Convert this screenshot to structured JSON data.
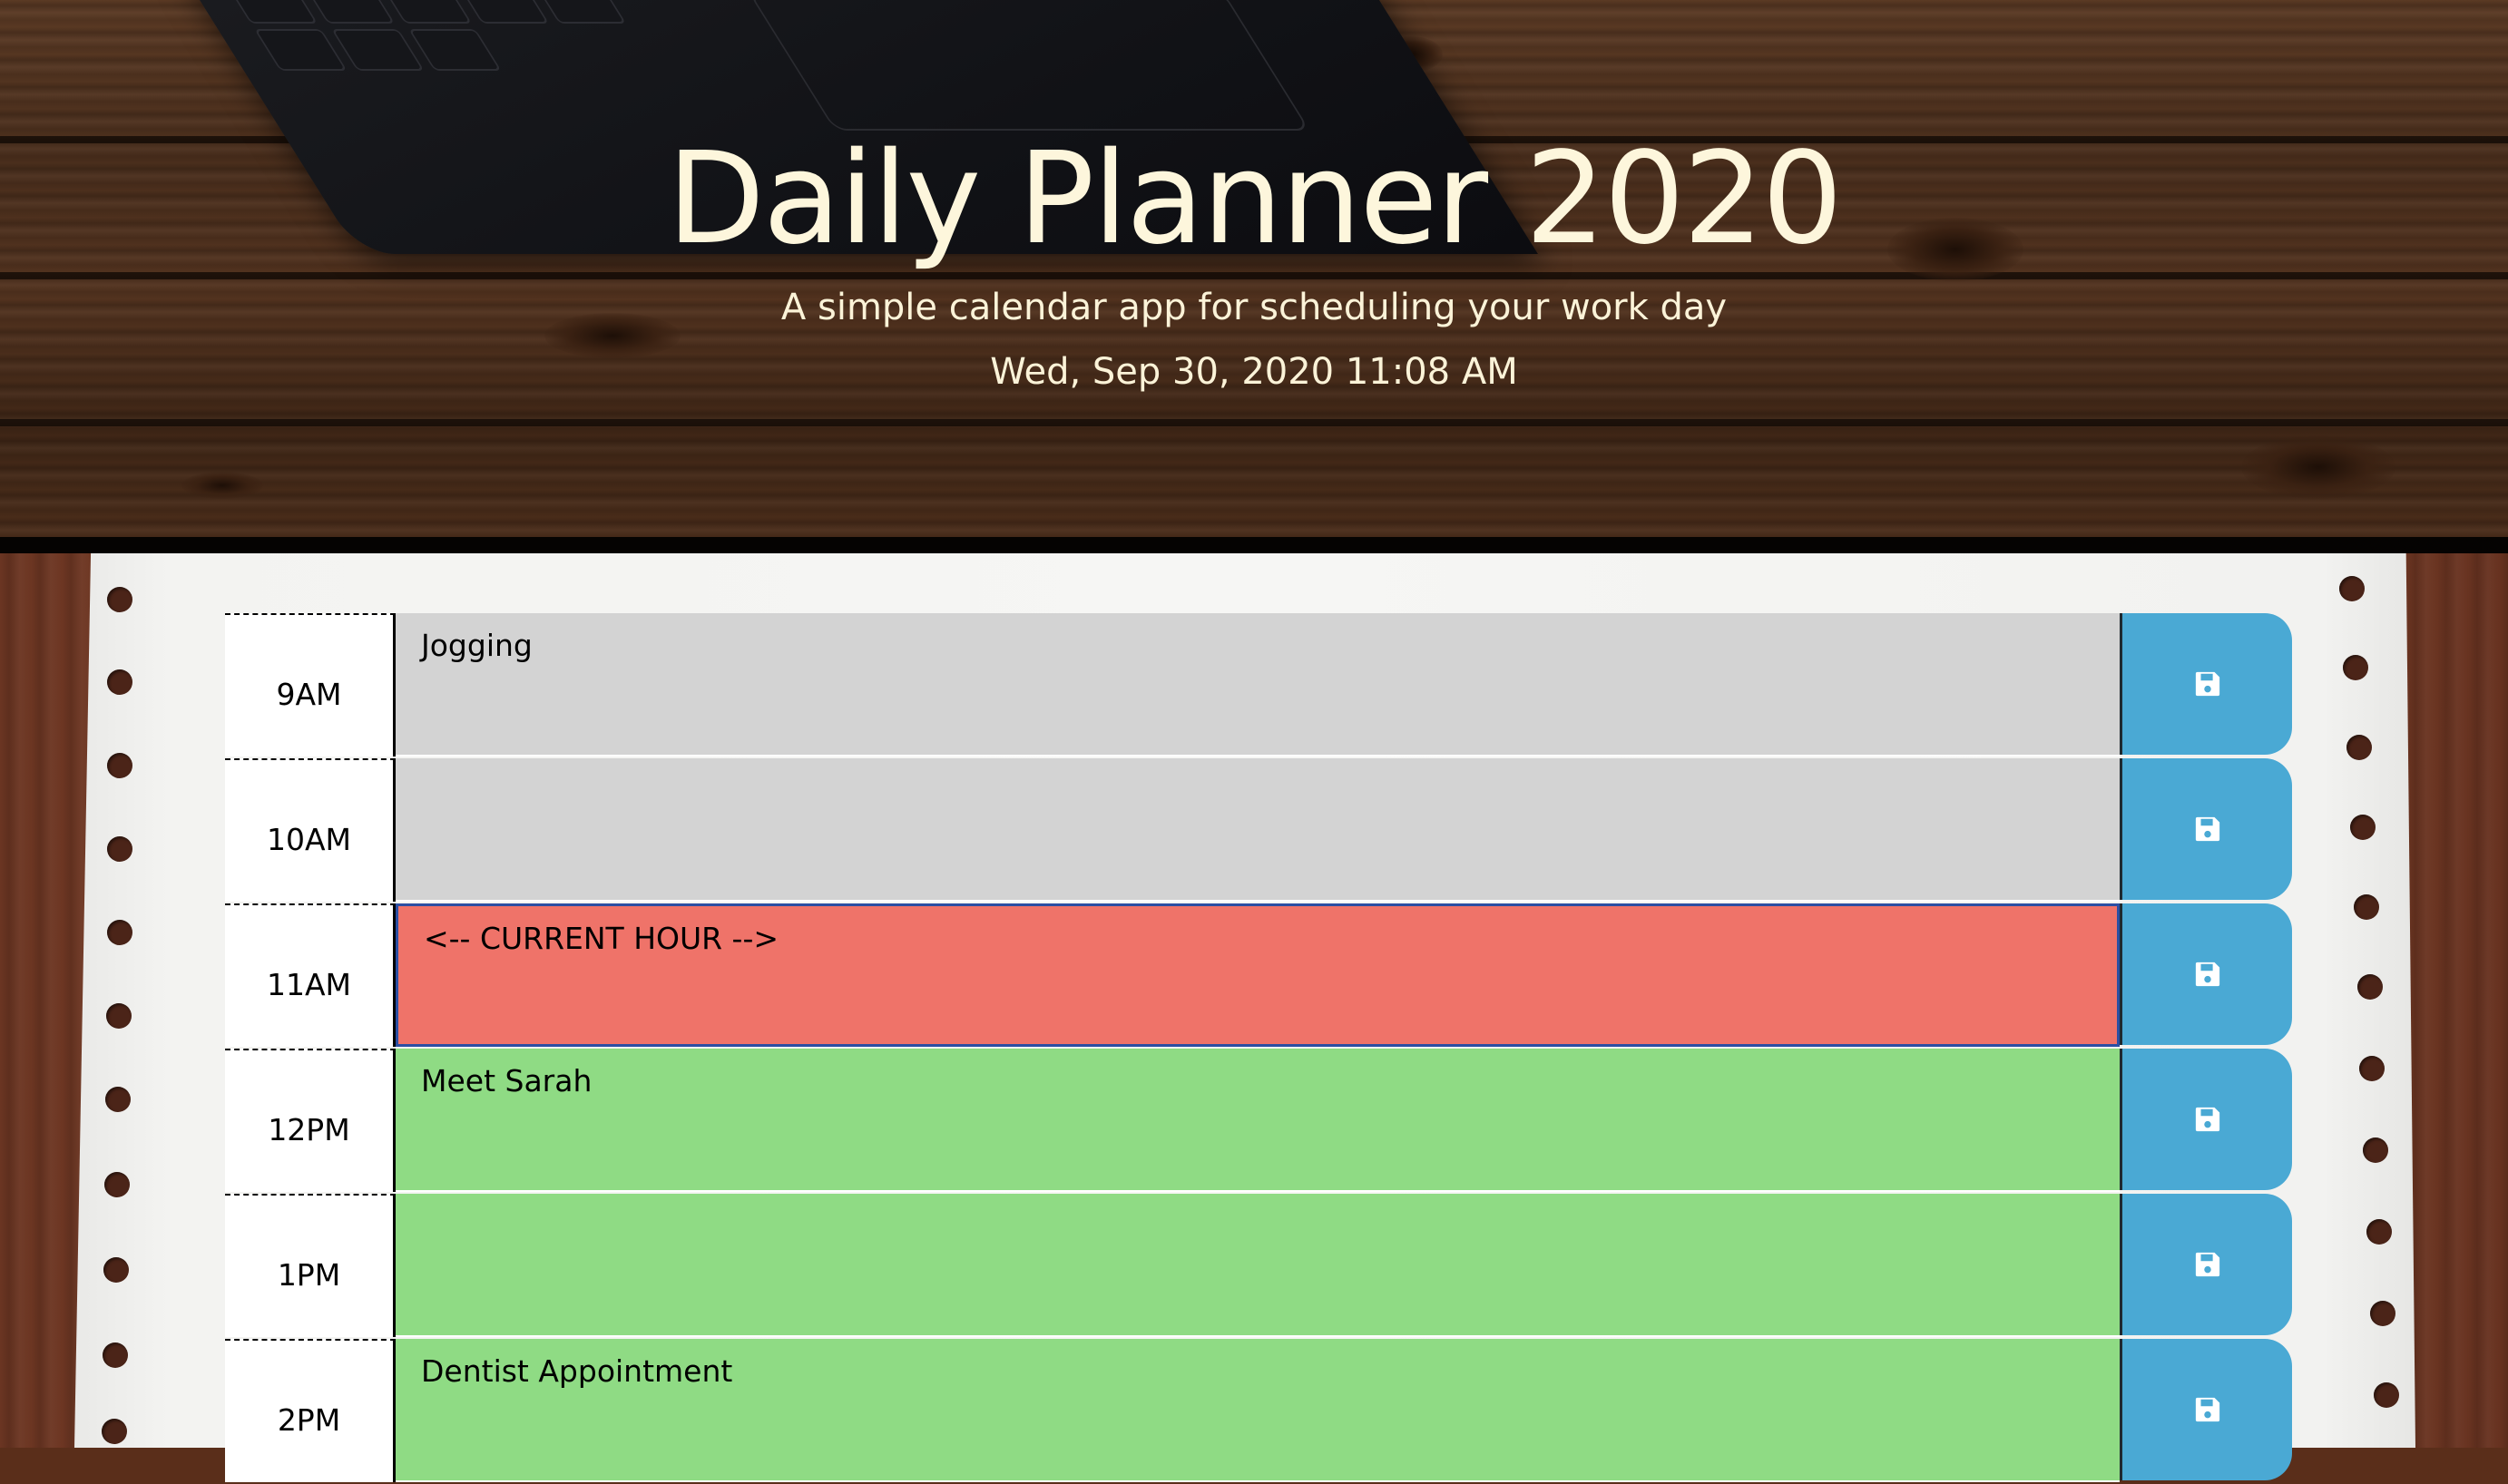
{
  "header": {
    "title": "Daily Planner 2020",
    "subtitle": "A simple calendar app for scheduling your work day",
    "current_datetime": "Wed, Sep 30, 2020 11:08 AM"
  },
  "colors": {
    "past": "#d3d3d3",
    "present": "#ef7369",
    "future": "#8fdb84",
    "save_button": "#4aa9d4"
  },
  "time_blocks": [
    {
      "hour": "9AM",
      "text": "Jogging",
      "status": "past",
      "save_icon": "floppy-disk-icon"
    },
    {
      "hour": "10AM",
      "text": "",
      "status": "past",
      "save_icon": "floppy-disk-icon"
    },
    {
      "hour": "11AM",
      "text": "<-- CURRENT HOUR -->",
      "status": "present",
      "save_icon": "floppy-disk-icon"
    },
    {
      "hour": "12PM",
      "text": "Meet Sarah",
      "status": "future",
      "save_icon": "floppy-disk-icon"
    },
    {
      "hour": "1PM",
      "text": "",
      "status": "future",
      "save_icon": "floppy-disk-icon"
    },
    {
      "hour": "2PM",
      "text": "Dentist Appointment",
      "status": "future",
      "save_icon": "floppy-disk-icon"
    }
  ]
}
